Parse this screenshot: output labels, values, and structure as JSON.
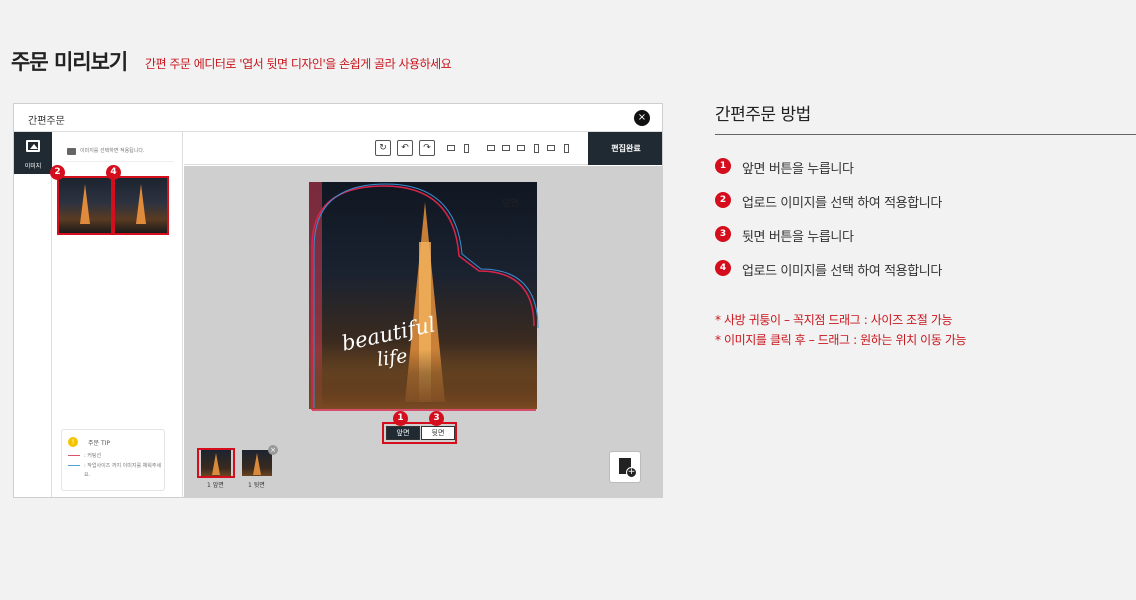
{
  "header": {
    "title": "주문 미리보기",
    "subtitle": "간편 주문 에디터로 '엽서 뒷면 디자인'을 손쉽게 골라 사용하세요"
  },
  "modal": {
    "title": "간편주문",
    "close": "×",
    "rail_label": "이미지",
    "panel_hint": "이미지를 선택하면 적용됩니다.",
    "tip": {
      "title": "주문 TIP",
      "line1": ": 커팅선",
      "line2": ": 작업사이즈 까지 이미지를 채워주세요."
    },
    "done_button": "편집완료",
    "photo_label": "앞면",
    "script_line1": "beautiful",
    "script_line2": "life",
    "face_front": "앞면",
    "face_back": "뒷면",
    "page_front": "1 앞면",
    "page_back": "1 뒷면",
    "page_delete": "×",
    "tool_rotate": "↻",
    "tool_rotate_left": "↶",
    "tool_rotate_right": "↷",
    "add_plus": "+"
  },
  "markers": [
    "1",
    "2",
    "3",
    "4"
  ],
  "howto": {
    "title": "간편주문 방법",
    "steps": [
      {
        "num": "1",
        "text": "앞면 버튼을 누릅니다"
      },
      {
        "num": "2",
        "text": "업로드 이미지를 선택 하여 적용합니다"
      },
      {
        "num": "3",
        "text": "뒷면 버튼을 누릅니다"
      },
      {
        "num": "4",
        "text": "업로드 이미지를 선택 하여 적용합니다"
      }
    ],
    "notes": [
      "* 사방 귀퉁이 – 꼭지점 드래그 : 사이즈 조절 가능",
      "* 이미지를 클릭 후 – 드래그 : 원하는 위치 이동 가능"
    ]
  },
  "colors": {
    "accent_red": "#d40e1c",
    "note_red": "#c8161d",
    "dark_navy": "#1f2a33",
    "canvas_gray": "#cfcfcf"
  },
  "icons": [
    "close-icon",
    "image-icon",
    "chat-icon",
    "rotate-icon",
    "rotate-left-90-icon",
    "rotate-right-90-icon",
    "align-icon",
    "add-page-icon",
    "info-icon"
  ]
}
